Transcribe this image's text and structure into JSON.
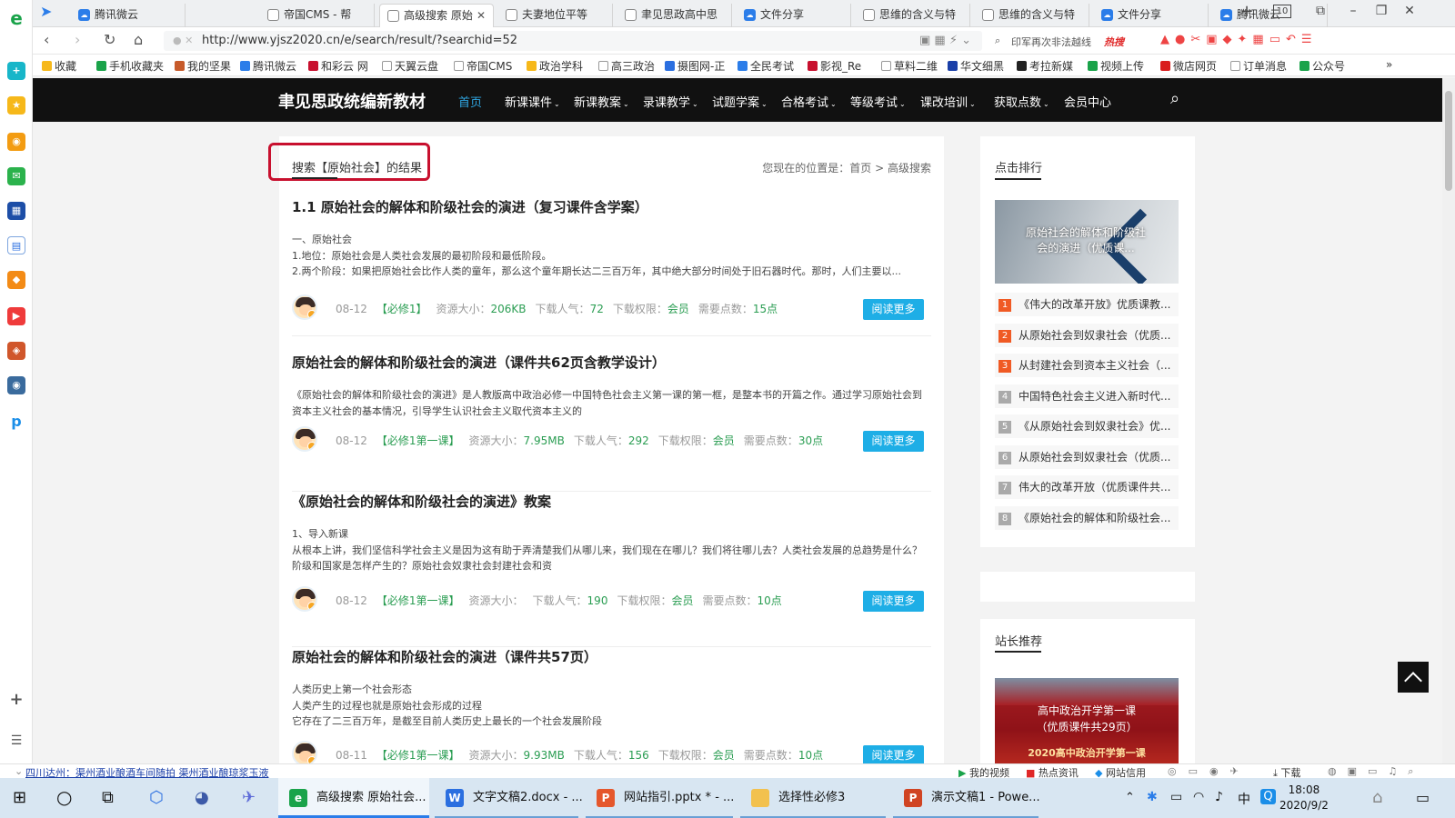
{
  "browser": {
    "tabs": [
      {
        "title": "腾讯微云",
        "icon": "cloud"
      },
      {
        "title": "帝国CMS - 帮",
        "icon": "doc"
      },
      {
        "title": "高级搜索 原始",
        "icon": "doc",
        "active": true
      },
      {
        "title": "夫妻地位平等",
        "icon": "doc"
      },
      {
        "title": "聿见思政高中思",
        "icon": "doc"
      },
      {
        "title": "文件分享",
        "icon": "cloud"
      },
      {
        "title": "思维的含义与特",
        "icon": "doc"
      },
      {
        "title": "思维的含义与特",
        "icon": "doc"
      },
      {
        "title": "文件分享",
        "icon": "cloud"
      },
      {
        "title": "腾讯微云",
        "icon": "cloud"
      }
    ],
    "tab_count": "10",
    "url": "http://www.yjsz2020.cn/e/search/result/?searchid=52",
    "address_right": {
      "promo": "印军再次非法越线",
      "hot": "热搜"
    },
    "bookmarks": [
      "收藏",
      "手机收藏夹",
      "我的坚果",
      "腾讯微云",
      "和彩云 网",
      "天翼云盘",
      "帝国CMS",
      "政治学科",
      "高三政治",
      "摄图网-正",
      "全民考试",
      "影视_Re",
      "草料二维",
      "华文细黑",
      "考拉新媒",
      "视频上传",
      "微店网页",
      "订单消息",
      "公众号"
    ]
  },
  "site": {
    "logo": "聿见思政统编新教材",
    "nav": [
      {
        "label": "首页",
        "active": true,
        "dropdown": false
      },
      {
        "label": "新课课件",
        "dropdown": true
      },
      {
        "label": "新课教案",
        "dropdown": true
      },
      {
        "label": "录课教学",
        "dropdown": true
      },
      {
        "label": "试题学案",
        "dropdown": true
      },
      {
        "label": "合格考试",
        "dropdown": true
      },
      {
        "label": "等级考试",
        "dropdown": true
      },
      {
        "label": "课改培训",
        "dropdown": true
      },
      {
        "label": "获取点数",
        "dropdown": true
      },
      {
        "label": "会员中心",
        "dropdown": false
      }
    ]
  },
  "search": {
    "heading": "搜索【原始社会】的结果",
    "breadcrumb_prefix": "您现在的位置是：",
    "breadcrumb_home": "首页",
    "breadcrumb_sep": " > ",
    "breadcrumb_current": "高级搜索"
  },
  "meta_labels": {
    "size": "资源大小：",
    "downloads": "下载人气：",
    "permission": "下载权限：",
    "points": "需要点数："
  },
  "results": [
    {
      "title": "1.1 原始社会的解体和阶级社会的演进（复习课件含学案）",
      "excerpt": [
        "一、原始社会",
        "1.地位：原始社会是人类社会发展的最初阶段和最低阶段。",
        "2.两个阶段：如果把原始社会比作人类的童年，那么这个童年期长达二三百万年，其中绝大部分时间处于旧石器时代。那时，人们主要以..."
      ],
      "date": "08-12",
      "tag": "【必修1】",
      "size": "206KB",
      "downloads": "72",
      "permission": "会员",
      "points": "15点",
      "button": "阅读更多"
    },
    {
      "title": "原始社会的解体和阶级社会的演进（课件共62页含教学设计）",
      "excerpt": [
        "《原始社会的解体和阶级社会的演进》是人教版高中政治必修一中国特色社会主义第一课的第一框，是整本书的开篇之作。通过学习原始社会到资本主义社会的基本情况，引导学生认识社会主义取代资本主义的"
      ],
      "date": "08-12",
      "tag": "【必修1第一课】",
      "size": "7.95MB",
      "downloads": "292",
      "permission": "会员",
      "points": "30点",
      "button": "阅读更多"
    },
    {
      "title": "《原始社会的解体和阶级社会的演进》教案",
      "excerpt": [
        "1、导入新课",
        "从根本上讲，我们坚信科学社会主义是因为这有助于弄清楚我们从哪儿来，我们现在在哪儿？我们将往哪儿去？人类社会发展的总趋势是什么？阶级和国家是怎样产生的？原始社会奴隶社会封建社会和资"
      ],
      "date": "08-12",
      "tag": "【必修1第一课】",
      "size": "",
      "downloads": "190",
      "permission": "会员",
      "points": "10点",
      "button": "阅读更多"
    },
    {
      "title": "原始社会的解体和阶级社会的演进（课件共57页）",
      "excerpt": [
        "人类历史上第一个社会形态",
        "人类产生的过程也就是原始社会形成的过程",
        "它存在了二三百万年，是截至目前人类历史上最长的一个社会发展阶段"
      ],
      "date": "08-11",
      "tag": "【必修1第一课】",
      "size": "9.93MB",
      "downloads": "156",
      "permission": "会员",
      "points": "10点",
      "button": "阅读更多"
    }
  ],
  "sidebar": {
    "rank_title": "点击排行",
    "thumb_text": "原始社会的解体和阶级社会的演进（优质课...",
    "rank_items": [
      {
        "num": "1",
        "title": "《伟大的改革开放》优质课教...",
        "color": "#f05a24"
      },
      {
        "num": "2",
        "title": "从原始社会到奴隶社会（优质...",
        "color": "#f05a24"
      },
      {
        "num": "3",
        "title": "从封建社会到资本主义社会（...",
        "color": "#f05a24"
      },
      {
        "num": "4",
        "title": "中国特色社会主义进入新时代...",
        "color": "#aaaaaa"
      },
      {
        "num": "5",
        "title": "《从原始社会到奴隶社会》优...",
        "color": "#aaaaaa"
      },
      {
        "num": "6",
        "title": "从原始社会到奴隶社会（优质...",
        "color": "#aaaaaa"
      },
      {
        "num": "7",
        "title": "伟大的改革开放（优质课件共...",
        "color": "#aaaaaa"
      },
      {
        "num": "8",
        "title": "《原始社会的解体和阶级社会...",
        "color": "#aaaaaa"
      }
    ],
    "rec_title": "站长推荐",
    "rec_text1": "高中政治开学第一课",
    "rec_text2": "（优质课件共29页）",
    "rec_text3": "2020高中政治开学第一课"
  },
  "statusbar": {
    "ticker": "四川达州：渠州酒业酿酒车间随拍 渠州酒业酿琼浆玉液",
    "right": [
      "我的视频",
      "热点资讯",
      "网站信用",
      "下载"
    ]
  },
  "taskbar": {
    "apps": [
      {
        "label": "高级搜索 原始社会...",
        "color": "#1aa34a",
        "letter": "e",
        "active": true
      },
      {
        "label": "文字文稿2.docx - ...",
        "color": "#2b6fe0",
        "letter": "W"
      },
      {
        "label": "网站指引.pptx * - ...",
        "color": "#e5572c",
        "letter": "P"
      },
      {
        "label": "选择性必修3",
        "color": "#f2c14e",
        "letter": ""
      },
      {
        "label": "演示文稿1 - Powe...",
        "color": "#d04423",
        "letter": "P"
      }
    ],
    "ime": "中",
    "time": "18:08",
    "date": "2020/9/2"
  }
}
